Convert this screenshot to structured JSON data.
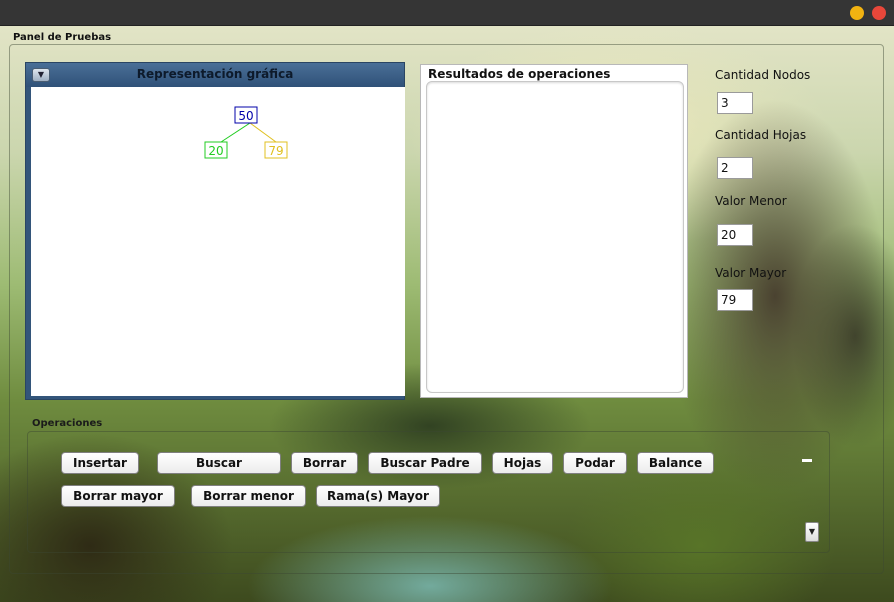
{
  "panel": {
    "title": "Panel de Pruebas"
  },
  "graph": {
    "title": "Representación gráfica",
    "toggle_icon": "chevron-down-icon",
    "tree": {
      "root": {
        "value": "50",
        "color": "#0000aa"
      },
      "left": {
        "value": "20",
        "color": "#22cc22"
      },
      "right": {
        "value": "79",
        "color": "#e0c020"
      }
    }
  },
  "results": {
    "title": "Resultados de operaciones",
    "value": ""
  },
  "stats": {
    "nodes_label": "Cantidad Nodos",
    "nodes_value": "3",
    "leaves_label": "Cantidad Hojas",
    "leaves_value": "2",
    "min_label": "Valor Menor",
    "min_value": "20",
    "max_label": "Valor Mayor",
    "max_value": "79"
  },
  "operations": {
    "title": "Operaciones",
    "insert": "Insertar",
    "search": "Buscar",
    "delete": "Borrar",
    "search_parent": "Buscar Padre",
    "leaves": "Hojas",
    "prune": "Podar",
    "balance": "Balance",
    "delete_max": "Borrar mayor",
    "delete_min": "Borrar menor",
    "branch_max": "Rama(s) Mayor"
  },
  "colors": {
    "titlebar": "#353535",
    "minimize": "#f2b311",
    "close": "#e8473a",
    "graph_header": "#33557a"
  }
}
